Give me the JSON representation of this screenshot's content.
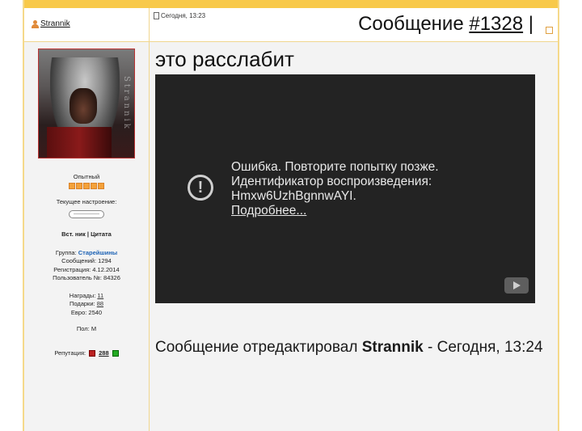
{
  "post": {
    "username": "Strannik",
    "date": "Сегодня, 13:23",
    "title_prefix": "Сообщение ",
    "number": "#1328",
    "title_suffix": " |",
    "text": "это расслабит",
    "edited_prefix": "Сообщение отредактировал ",
    "edited_user": "Strannik",
    "edited_suffix": " - Сегодня, 13:24"
  },
  "profile": {
    "rank": "Опытный",
    "stars": 5,
    "mood_label": "Текущее настроение:",
    "mood_value": "----------------",
    "insert_nick": "Вст. ник",
    "separator": " | ",
    "quote": "Цитата",
    "group_label": "Группа: ",
    "group": "Старейшины",
    "messages": "Сообщений: 1294",
    "registration": "Регистрация: 4.12.2014",
    "user_no": "Пользователь №: 84326",
    "awards_label": "Награды: ",
    "awards": "11",
    "gifts_label": "Подарки: ",
    "gifts": "88",
    "euro": "Евро: 2540",
    "gender": "Пол: М",
    "reputation_label": "Репутация:",
    "reputation": "288",
    "avatar_signature": "Strannik"
  },
  "video": {
    "error_line1": "Ошибка. Повторите попытку позже.",
    "error_line2": "Идентификатор воспроизведения:",
    "error_line3": "Hmxw6UzhBgnnwAYI.",
    "more": "Подробнее...",
    "error_icon": "!"
  },
  "colors": {
    "topbar": "#f8c94a",
    "group": "#1d63b5",
    "star": "#f4a23a",
    "video_bg": "#232323"
  }
}
